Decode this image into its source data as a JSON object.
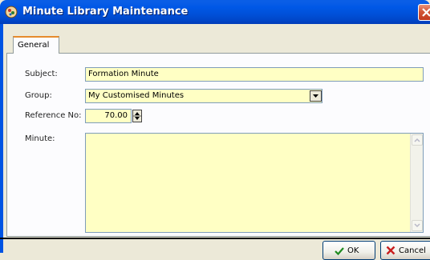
{
  "window": {
    "title": "Minute Library Maintenance"
  },
  "tabs": [
    {
      "label": "General"
    }
  ],
  "form": {
    "subject": {
      "label": "Subject:",
      "value": "Formation Minute"
    },
    "group": {
      "label": "Group:",
      "value": "My Customised Minutes"
    },
    "reference_no": {
      "label": "Reference No:",
      "value": "70.00"
    },
    "minute": {
      "label": "Minute:",
      "value": ""
    }
  },
  "buttons": {
    "ok": "OK",
    "cancel": "Cancel"
  }
}
